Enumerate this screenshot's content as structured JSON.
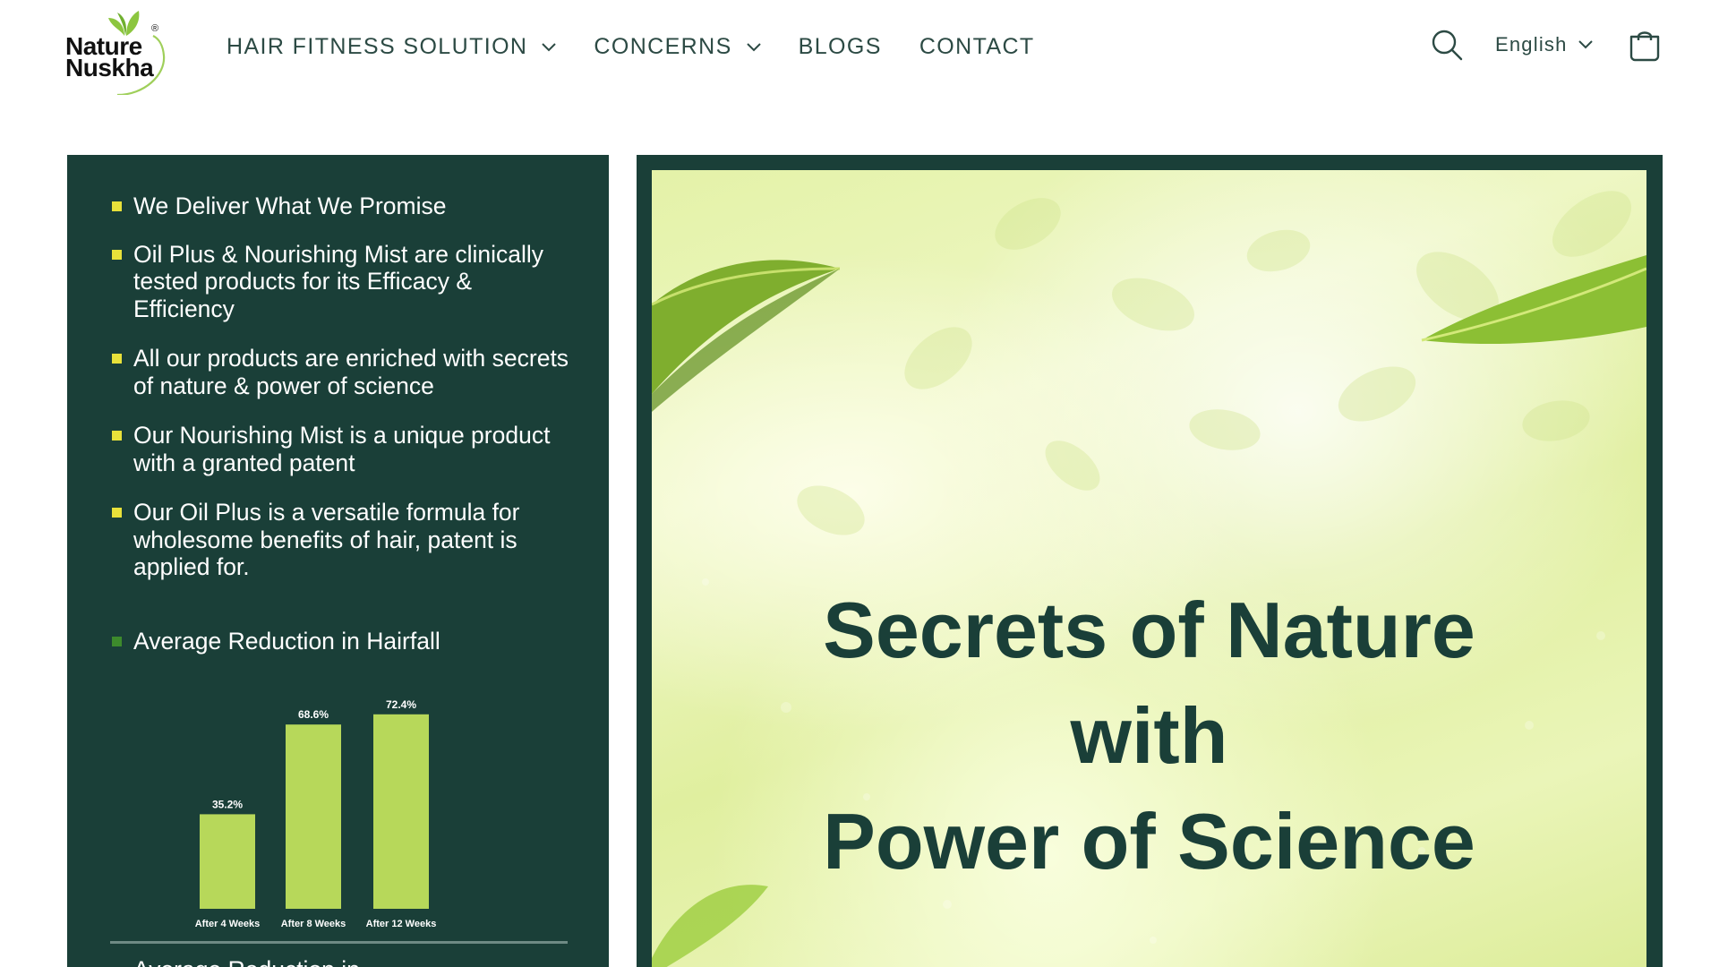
{
  "brand": {
    "logo_line1": "Nature",
    "logo_line2": "Nuskha",
    "registered_mark": "®"
  },
  "nav": {
    "items": [
      {
        "label": "HAIR FITNESS SOLUTION",
        "has_dropdown": true
      },
      {
        "label": "CONCERNS",
        "has_dropdown": true
      },
      {
        "label": "BLOGS",
        "has_dropdown": false
      },
      {
        "label": "CONTACT",
        "has_dropdown": false
      }
    ]
  },
  "tools": {
    "language": "English"
  },
  "left_panel": {
    "bullets": [
      {
        "text": "We Deliver What We Promise"
      },
      {
        "text": "Oil Plus & Nourishing Mist are clinically tested products for its Efficacy & Efficiency"
      },
      {
        "text": "All our products are enriched with secrets of nature & power of science"
      },
      {
        "text": "Our Nourishing Mist is a unique product with a granted patent"
      },
      {
        "text": "Our Oil Plus is a versatile formula for wholesome benefits of hair, patent is applied for."
      }
    ],
    "chart_heading": "Average Reduction in Hairfall",
    "cut_text": "Average Reduction in"
  },
  "chart_data": {
    "type": "bar",
    "title": "Average Reduction in Hairfall",
    "categories": [
      "After 4 Weeks",
      "After 8 Weeks",
      "After 12 Weeks"
    ],
    "values": [
      35.2,
      68.6,
      72.4
    ],
    "data_labels": [
      "35.2%",
      "68.6%",
      "72.4%"
    ],
    "unit": "%",
    "ylim": [
      0,
      80
    ],
    "grid": false,
    "bar_color": "#b7d85a"
  },
  "hero": {
    "title_line1": "Secrets of Nature",
    "title_line2": "with",
    "title_line3": "Power of Science"
  },
  "colors": {
    "dark_green": "#1a3f38",
    "nav_text": "#2c4a44",
    "bullet_yellow": "#e8e13a",
    "bar_green": "#b7d85a"
  }
}
